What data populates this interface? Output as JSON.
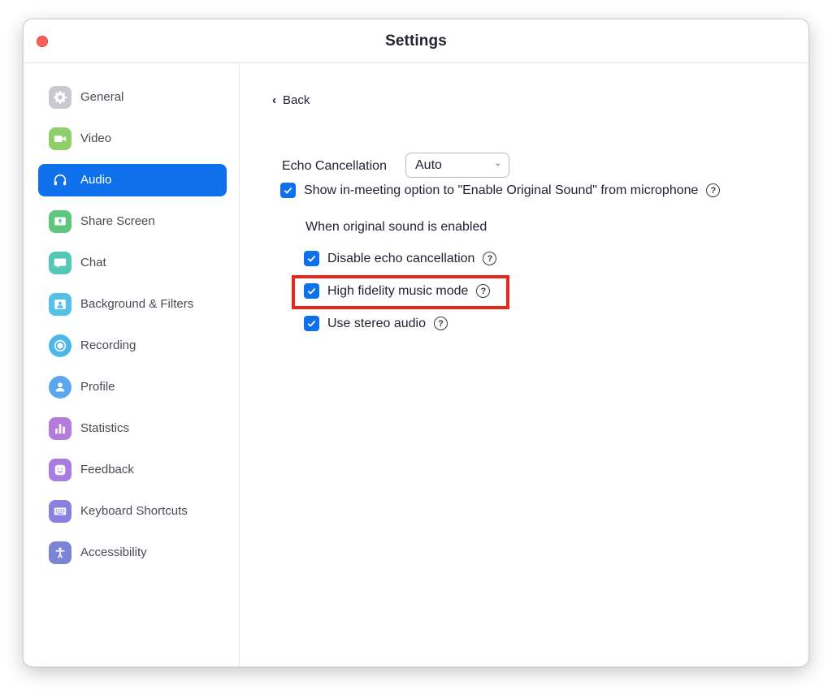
{
  "window": {
    "title": "Settings"
  },
  "sidebar": {
    "items": [
      {
        "label": "General",
        "icon": "gear-icon",
        "color": "#c9c9cf"
      },
      {
        "label": "Video",
        "icon": "video-camera-icon",
        "color": "#8fcf6a"
      },
      {
        "label": "Audio",
        "icon": "headphones-icon",
        "color": "#0e71eb",
        "active": true
      },
      {
        "label": "Share Screen",
        "icon": "share-screen-icon",
        "color": "#5ec77d"
      },
      {
        "label": "Chat",
        "icon": "chat-bubble-icon",
        "color": "#55c7b6"
      },
      {
        "label": "Background & Filters",
        "icon": "background-icon",
        "color": "#57c0e6"
      },
      {
        "label": "Recording",
        "icon": "record-icon",
        "color": "#4cb8ea"
      },
      {
        "label": "Profile",
        "icon": "profile-icon",
        "color": "#5aa7ee"
      },
      {
        "label": "Statistics",
        "icon": "bar-chart-icon",
        "color": "#b57bd9"
      },
      {
        "label": "Feedback",
        "icon": "smiley-icon",
        "color": "#a87ce0"
      },
      {
        "label": "Keyboard Shortcuts",
        "icon": "keyboard-icon",
        "color": "#8a80e0"
      },
      {
        "label": "Accessibility",
        "icon": "accessibility-icon",
        "color": "#7c84d6"
      }
    ]
  },
  "content": {
    "back_label": "Back",
    "echo": {
      "label": "Echo Cancellation",
      "value": "Auto"
    },
    "original_sound": {
      "label": "Show in-meeting option to \"Enable Original Sound\" from microphone",
      "checked": true
    },
    "subheading": "When original sound is enabled",
    "options": [
      {
        "label": "Disable echo cancellation",
        "checked": true
      },
      {
        "label": "High fidelity music mode",
        "checked": true,
        "highlighted": true
      },
      {
        "label": "Use stereo audio",
        "checked": true
      }
    ],
    "help_glyph": "?",
    "highlight_color": "#e8261c",
    "accent_color": "#0e71eb"
  }
}
